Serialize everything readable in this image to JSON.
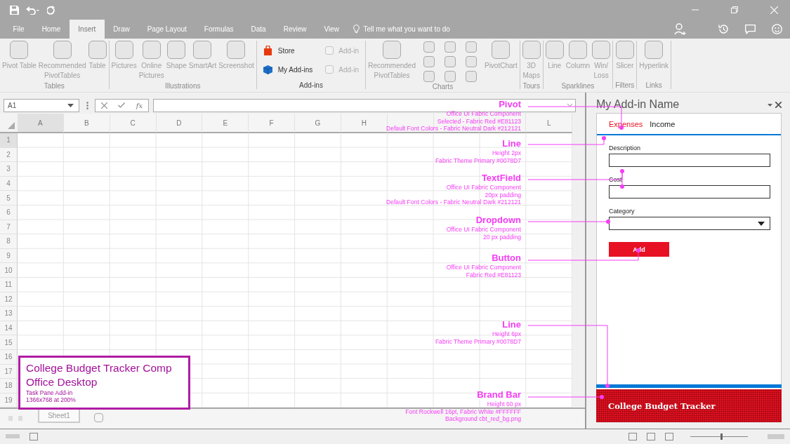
{
  "tabs": [
    {
      "label": "File",
      "selected": false
    },
    {
      "label": "Home",
      "selected": false
    },
    {
      "label": "Insert",
      "selected": true
    },
    {
      "label": "Draw",
      "selected": false
    },
    {
      "label": "Page Layout",
      "selected": false
    },
    {
      "label": "Formulas",
      "selected": false
    },
    {
      "label": "Data",
      "selected": false
    },
    {
      "label": "Review",
      "selected": false
    },
    {
      "label": "View",
      "selected": false
    }
  ],
  "tell_me": "Tell me what you want to do",
  "ribbon": {
    "groups": [
      {
        "label": "Tables",
        "disabled": true,
        "items": [
          {
            "kind": "large",
            "label": "Pivot Table",
            "disabled": true
          },
          {
            "kind": "large",
            "label": "Recommended\nPivotTables",
            "disabled": true
          },
          {
            "kind": "large",
            "label": "Table",
            "disabled": true
          }
        ]
      },
      {
        "label": "Illustrations",
        "disabled": true,
        "items": [
          {
            "kind": "large",
            "label": "Pictures",
            "disabled": true
          },
          {
            "kind": "large",
            "label": "Online\nPictures",
            "disabled": true
          },
          {
            "kind": "large",
            "label": "Shape",
            "disabled": true
          },
          {
            "kind": "large",
            "label": "SmartArt",
            "disabled": true
          },
          {
            "kind": "large",
            "label": "Screenshot",
            "disabled": true
          }
        ]
      },
      {
        "label": "Add-ins",
        "disabled": false,
        "items": [
          {
            "kind": "app",
            "label": "Store",
            "disabled": false
          },
          {
            "kind": "app",
            "label": "My Add-ins",
            "disabled": false
          },
          {
            "kind": "check",
            "label": "Add-in",
            "disabled": true,
            "checked": false
          },
          {
            "kind": "check",
            "label": "Add-in",
            "disabled": true,
            "checked": false
          }
        ]
      },
      {
        "label": "Charts",
        "disabled": true,
        "items": [
          {
            "kind": "large",
            "label": "Recommended\nPivotTables",
            "disabled": true
          },
          {
            "kind": "grid",
            "disabled": true
          },
          {
            "kind": "large",
            "label": "PivotChart",
            "disabled": true
          }
        ]
      },
      {
        "label": "Tours",
        "disabled": true,
        "items": [
          {
            "kind": "large",
            "label": "3D\nMaps",
            "disabled": true
          }
        ]
      },
      {
        "label": "Sparklines",
        "disabled": true,
        "items": [
          {
            "kind": "large",
            "label": "Line",
            "disabled": true
          },
          {
            "kind": "large",
            "label": "Column",
            "disabled": true
          },
          {
            "kind": "large",
            "label": "Win/\nLoss",
            "disabled": true
          }
        ]
      },
      {
        "label": "Filters",
        "disabled": true,
        "items": [
          {
            "kind": "large",
            "label": "Slicer",
            "disabled": true
          }
        ]
      },
      {
        "label": "Links",
        "disabled": true,
        "items": [
          {
            "kind": "large",
            "label": "Hyperlink",
            "disabled": true
          }
        ]
      }
    ]
  },
  "formula_bar": {
    "name_box": "A1",
    "function_label": "fx"
  },
  "grid": {
    "columns": [
      {
        "label": "A",
        "selected": true
      },
      {
        "label": "B",
        "selected": false
      },
      {
        "label": "C",
        "selected": false
      },
      {
        "label": "D",
        "selected": false
      },
      {
        "label": "E",
        "selected": false
      },
      {
        "label": "F",
        "selected": false
      },
      {
        "label": "G",
        "selected": false
      },
      {
        "label": "H",
        "selected": false
      },
      {
        "selected": false
      },
      {
        "selected": false
      },
      {
        "selected": false
      },
      {
        "label": "L",
        "selected": false
      }
    ],
    "rows": [
      {
        "label": "1",
        "selected": true
      },
      {
        "label": "2",
        "selected": false
      },
      {
        "label": "3",
        "selected": false
      },
      {
        "label": "4",
        "selected": false
      },
      {
        "label": "5",
        "selected": false
      },
      {
        "label": "6",
        "selected": false
      },
      {
        "label": "7",
        "selected": false
      },
      {
        "label": "8",
        "selected": false
      },
      {
        "label": "9",
        "selected": false
      },
      {
        "label": "10",
        "selected": false
      },
      {
        "label": "11",
        "selected": false
      },
      {
        "label": "12",
        "selected": false
      },
      {
        "label": "13",
        "selected": false
      },
      {
        "label": "14",
        "selected": false
      },
      {
        "label": "15",
        "selected": false
      },
      {
        "label": "16",
        "selected": false
      },
      {
        "label": "17",
        "selected": false
      },
      {
        "label": "18",
        "selected": false
      },
      {
        "label": "19",
        "selected": false
      }
    ]
  },
  "sheet_tabs": [
    "Sheet1"
  ],
  "task_pane": {
    "title": "My Add-in Name",
    "pivots": [
      {
        "label": "Expenses",
        "selected": true
      },
      {
        "label": "Income",
        "selected": false
      }
    ],
    "fields": [
      {
        "kind": "text",
        "label": "Description"
      },
      {
        "kind": "text",
        "label": "Cost"
      },
      {
        "kind": "dropdown",
        "label": "Category"
      }
    ],
    "button": "Add",
    "brand": "College Budget Tracker"
  },
  "status_bar": {
    "zoom": {
      "level": 0.55
    }
  },
  "annotations": [
    {
      "title": "Pivot",
      "notes": [
        "Office UI Fabric Component",
        "Selected - Fabric Red #E81123",
        "Default Font Colors - Fabric Neutral Dark #212121"
      ]
    },
    {
      "title": "Line",
      "notes": [
        "Height 2px",
        "Fabric Theme Primary #0078D7"
      ]
    },
    {
      "title": "TextField",
      "notes": [
        "Office UI Fabric Component",
        "20px padding",
        "Default Font Colors - Fabric Neutral Dark #212121"
      ]
    },
    {
      "title": "Dropdown",
      "notes": [
        "Office UI Fabric Component",
        "20 px padding"
      ]
    },
    {
      "title": "Button",
      "notes": [
        "Office UI Fabric Component",
        "Fabric Red #E81123"
      ]
    },
    {
      "title": "Line",
      "notes": [
        "Height 6px",
        "Fabric Theme Primary #0078D7"
      ]
    },
    {
      "title": "Brand Bar",
      "notes": [
        "Height 60 px",
        "Font Rockwell 16pt, Fabric White #FFFFFF",
        "Background cbt_red_bg.png"
      ]
    }
  ],
  "note": {
    "headings": [
      "College Budget Tracker Comp",
      "Office Desktop"
    ],
    "details": [
      "Task Pane Add-in",
      "1366x768 at 200%"
    ]
  }
}
